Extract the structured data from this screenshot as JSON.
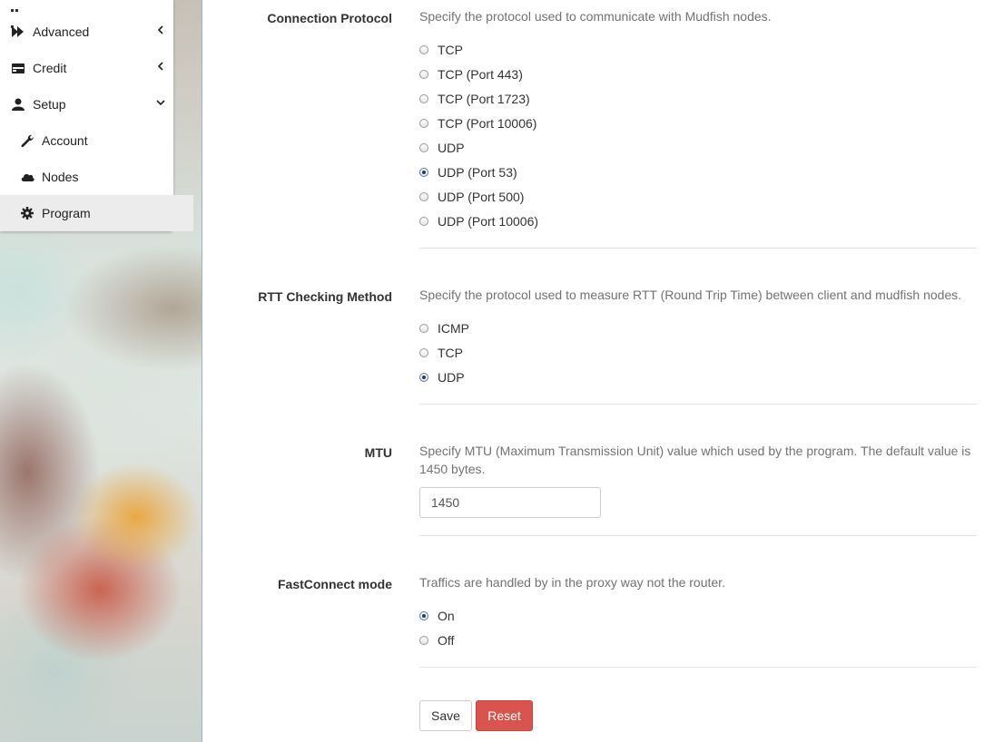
{
  "sidebar": {
    "items": [
      {
        "label": "Advanced",
        "icon": "fast-forward-icon",
        "chevron": "chevron-left-icon"
      },
      {
        "label": "Credit",
        "icon": "credit-card-icon",
        "chevron": "chevron-left-icon"
      },
      {
        "label": "Setup",
        "icon": "user-icon",
        "chevron": "chevron-down-icon"
      },
      {
        "label": "Account",
        "icon": "wrench-icon"
      },
      {
        "label": "Nodes",
        "icon": "cloud-icon"
      },
      {
        "label": "Program",
        "icon": "gear-icon",
        "active": true
      }
    ]
  },
  "form": {
    "connection_protocol": {
      "label": "Connection Protocol",
      "help": "Specify the protocol used to communicate with Mudfish nodes.",
      "options": [
        "TCP",
        "TCP (Port 443)",
        "TCP (Port 1723)",
        "TCP (Port 10006)",
        "UDP",
        "UDP (Port 53)",
        "UDP (Port 500)",
        "UDP (Port 10006)"
      ],
      "selected": "UDP (Port 53)"
    },
    "rtt_method": {
      "label": "RTT Checking Method",
      "help": "Specify the protocol used to measure RTT (Round Trip Time) between client and mudfish nodes.",
      "options": [
        "ICMP",
        "TCP",
        "UDP"
      ],
      "selected": "UDP"
    },
    "mtu": {
      "label": "MTU",
      "help_line1": "Specify MTU (Maximum Transmission Unit) value which used by the program. The default value is",
      "help_line2": "1450 bytes.",
      "value": "1450"
    },
    "fastconnect": {
      "label": "FastConnect mode",
      "help": "Traffics are handled by in the proxy way not the router.",
      "options": [
        "On",
        "Off"
      ],
      "selected": "On"
    },
    "buttons": {
      "save": "Save",
      "reset": "Reset"
    }
  },
  "colors": {
    "reset_button": "#d9534f",
    "active_menu_bg": "#ececec"
  }
}
